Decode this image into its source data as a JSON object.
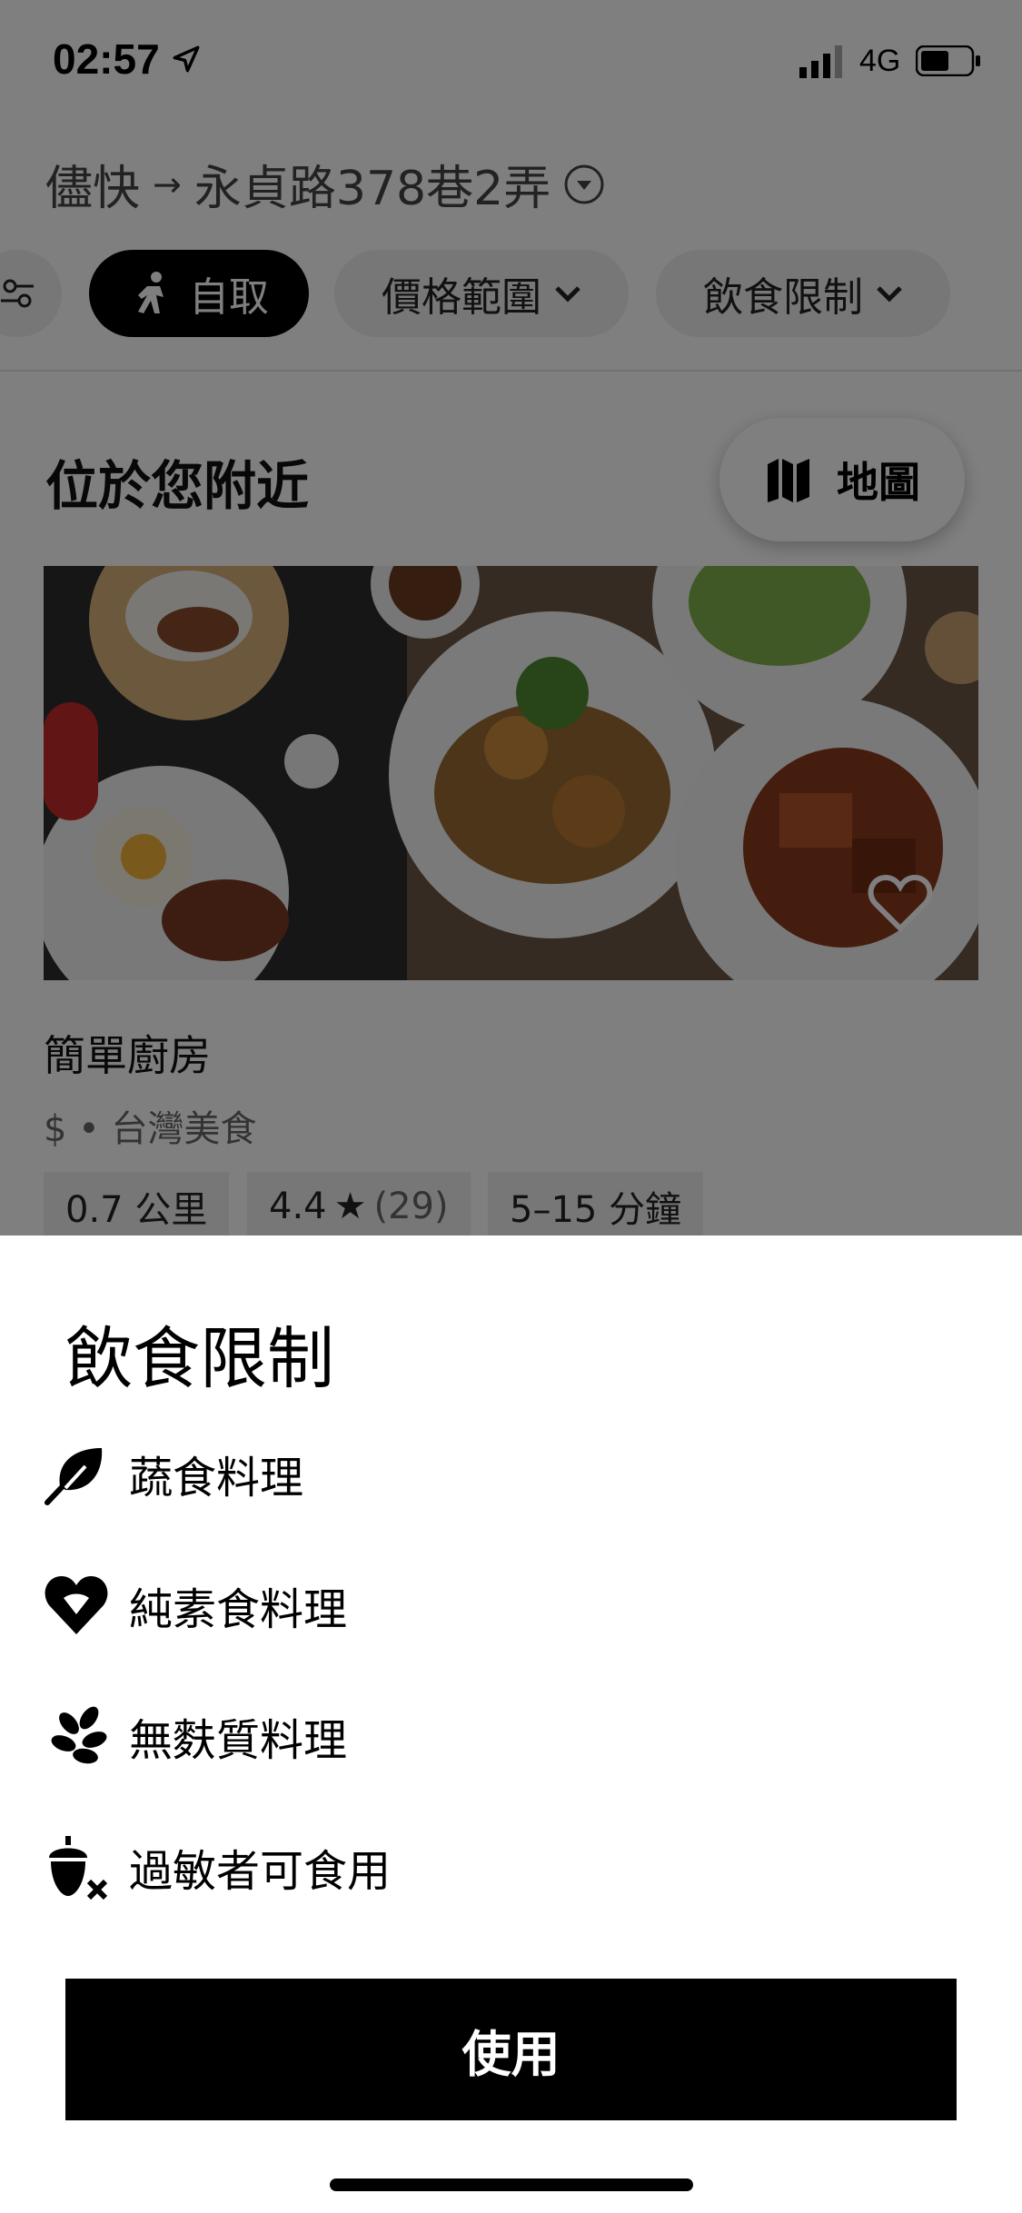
{
  "status_bar": {
    "time": "02:57",
    "network": "4G"
  },
  "address": {
    "from": "儘快",
    "arrow": "→",
    "to": "永貞路378巷2弄"
  },
  "filters": {
    "pickup_label": "自取",
    "price_label": "價格範圍",
    "diet_label": "飲食限制"
  },
  "nearby": {
    "title": "位於您附近",
    "map_label": "地圖"
  },
  "restaurant": {
    "name": "簡單廚房",
    "subtitle": "$ • 台灣美食",
    "distance": "0.7 公里",
    "rating": "4.4",
    "rating_count": "(29)",
    "eta": "5–15 分鐘"
  },
  "sheet": {
    "title": "飲食限制",
    "options": [
      {
        "label": "蔬食料理",
        "icon": "leaf-icon"
      },
      {
        "label": "純素食料理",
        "icon": "heart-leaf-icon"
      },
      {
        "label": "無麩質料理",
        "icon": "wheat-icon"
      },
      {
        "label": "過敏者可食用",
        "icon": "acorn-x-icon"
      }
    ],
    "apply_label": "使用"
  }
}
